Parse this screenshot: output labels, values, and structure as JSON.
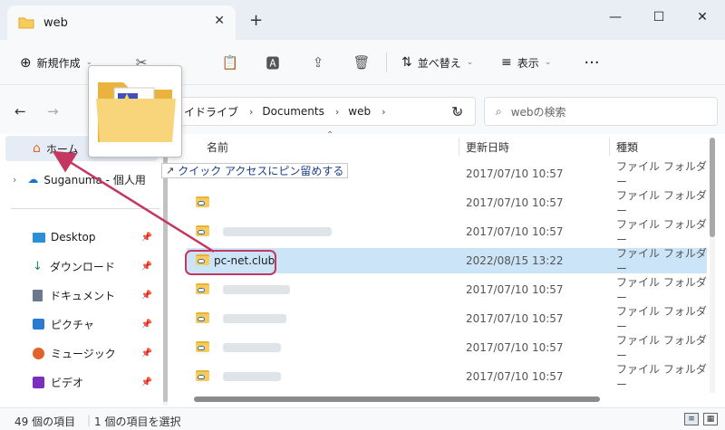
{
  "window": {
    "tab_title": "web"
  },
  "toolbar": {
    "new_label": "新規作成",
    "sort_label": "並べ替え",
    "view_label": "表示"
  },
  "address": {
    "crumbs": [
      "イドライブ",
      "Documents",
      "web"
    ],
    "search_placeholder": "webの検索"
  },
  "sidebar": {
    "home": "ホーム",
    "onedrive": "Suganuma - 個人用",
    "items": [
      {
        "label": "Desktop",
        "icon": "desktop-icon"
      },
      {
        "label": "ダウンロード",
        "icon": "download-icon"
      },
      {
        "label": "ドキュメント",
        "icon": "document-icon"
      },
      {
        "label": "ピクチャ",
        "icon": "picture-icon"
      },
      {
        "label": "ミュージック",
        "icon": "music-icon"
      },
      {
        "label": "ビデオ",
        "icon": "video-icon"
      }
    ]
  },
  "columns": {
    "name": "名前",
    "date": "更新日時",
    "type": "種類"
  },
  "rows": [
    {
      "name": "",
      "date": "2017/07/10 10:57",
      "type": "ファイル フォルダー",
      "blurred": true,
      "selected": false
    },
    {
      "name": "",
      "date": "2017/07/10 10:57",
      "type": "ファイル フォルダー",
      "blurred": true,
      "selected": false
    },
    {
      "name": "",
      "date": "2017/07/10 10:57",
      "type": "ファイル フォルダー",
      "blurred": true,
      "selected": false
    },
    {
      "name": "pc-net.club",
      "date": "2022/08/15 13:22",
      "type": "ファイル フォルダー",
      "blurred": false,
      "selected": true
    },
    {
      "name": "",
      "date": "2017/07/10 10:57",
      "type": "ファイル フォルダー",
      "blurred": true,
      "selected": false
    },
    {
      "name": "",
      "date": "2017/07/10 10:57",
      "type": "ファイル フォルダー",
      "blurred": true,
      "selected": false
    },
    {
      "name": "",
      "date": "2017/07/10 10:57",
      "type": "ファイル フォルダー",
      "blurred": true,
      "selected": false
    },
    {
      "name": "",
      "date": "2017/07/10 10:57",
      "type": "ファイル フォルダー",
      "blurred": true,
      "selected": false
    }
  ],
  "tooltip": "クイック アクセスにピン留めする",
  "status": {
    "count": "49 個の項目",
    "selection": "1 個の項目を選択"
  },
  "colors": {
    "selection": "#cce4f7",
    "annotation": "#c43760",
    "folder": "#f8cc5c"
  }
}
